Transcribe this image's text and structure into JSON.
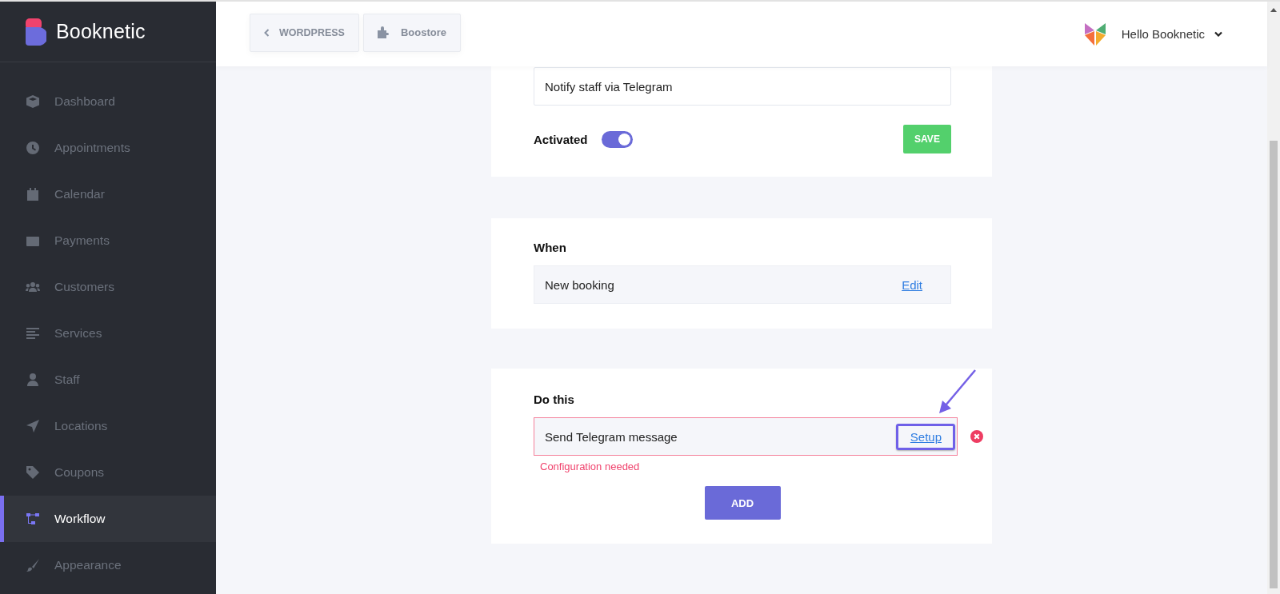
{
  "brand": {
    "name": "Booknetic"
  },
  "sidebar": {
    "items": [
      {
        "label": "Dashboard",
        "selected": false
      },
      {
        "label": "Appointments",
        "selected": false
      },
      {
        "label": "Calendar",
        "selected": false
      },
      {
        "label": "Payments",
        "selected": false
      },
      {
        "label": "Customers",
        "selected": false
      },
      {
        "label": "Services",
        "selected": false
      },
      {
        "label": "Staff",
        "selected": false
      },
      {
        "label": "Locations",
        "selected": false
      },
      {
        "label": "Coupons",
        "selected": false
      },
      {
        "label": "Workflow",
        "selected": true
      },
      {
        "label": "Appearance",
        "selected": false
      }
    ]
  },
  "header": {
    "back_button": "WORDPRESS",
    "store_button": "Boostore",
    "user_menu": "Hello Booknetic"
  },
  "workflow": {
    "name": "Notify staff via Telegram",
    "activated_label": "Activated",
    "activated": true,
    "save_button": "SAVE"
  },
  "when": {
    "title": "When",
    "trigger": "New booking",
    "edit_link": "Edit"
  },
  "do_this": {
    "title": "Do this",
    "actions": [
      {
        "label": "Send Telegram message",
        "link": "Setup",
        "highlighted": true,
        "error": "Configuration needed"
      }
    ],
    "add_button": "ADD"
  }
}
